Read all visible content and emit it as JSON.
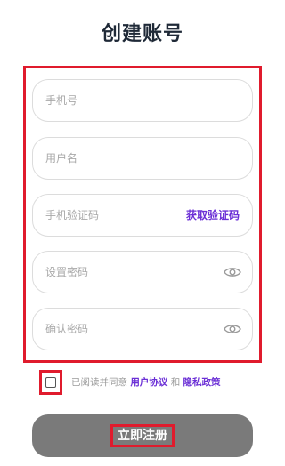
{
  "page": {
    "title": "创建账号"
  },
  "form": {
    "phone": {
      "placeholder": "手机号",
      "value": ""
    },
    "username": {
      "placeholder": "用户名",
      "value": ""
    },
    "sms_code": {
      "placeholder": "手机验证码",
      "value": "",
      "get_code_label": "获取验证码"
    },
    "password": {
      "placeholder": "设置密码",
      "value": "",
      "toggle_icon": "eye-icon"
    },
    "confirm_password": {
      "placeholder": "确认密码",
      "value": "",
      "toggle_icon": "eye-icon"
    }
  },
  "agreement": {
    "checked": false,
    "prefix": "已阅读并同意",
    "user_agreement": "用户协议",
    "and": "和",
    "privacy_policy": "隐私政策"
  },
  "submit": {
    "label": "立即注册"
  },
  "colors": {
    "accent": "#6b2fd6",
    "highlight_border": "#e01b2d",
    "button_bg": "#7a7a7a",
    "title": "#1f2937"
  }
}
